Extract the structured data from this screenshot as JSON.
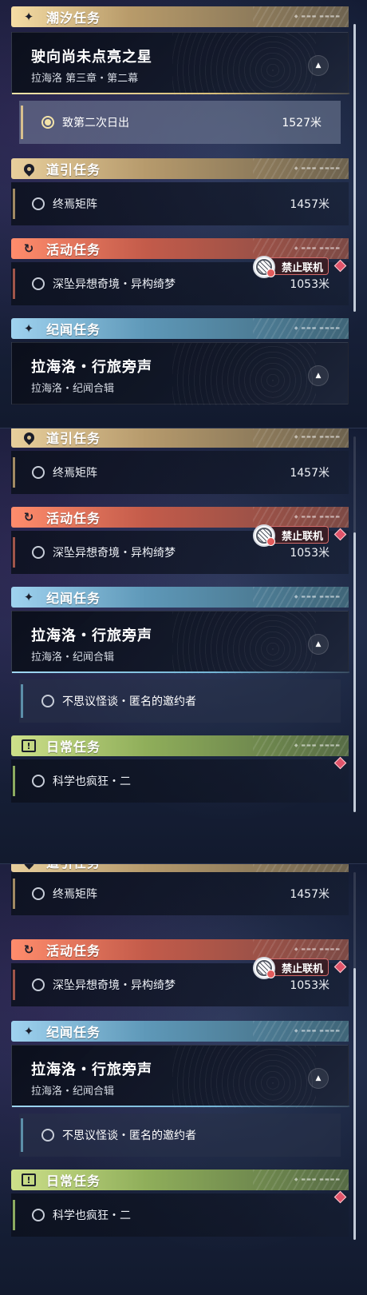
{
  "categories": {
    "tide": "潮汐任务",
    "guide": "道引任务",
    "event": "活动任务",
    "chronicle": "纪闻任务",
    "daily": "日常任务",
    "guide_cut": "道引任务"
  },
  "tide_quest": {
    "title": "驶向尚未点亮之星",
    "subtitle": "拉海洛 第三章・第二幕",
    "tracked_step": "致第二次日出",
    "tracked_distance": "1527米"
  },
  "guide_quest": {
    "name": "终焉矩阵",
    "distance": "1457米"
  },
  "event_quest": {
    "name": "深坠异想奇境・异构绮梦",
    "distance": "1053米",
    "badge": "禁止联机"
  },
  "chronicle_quest": {
    "title": "拉海洛・行旅旁声",
    "subtitle": "拉海洛・纪闻合辑",
    "sub_item": "不思议怪谈・匿名的邀约者"
  },
  "daily_quest": {
    "name": "科学也疯狂・二"
  },
  "icons": {
    "tide": "sparkle-icon",
    "guide": "map-pin-icon",
    "event": "cycle-icon",
    "chronicle": "sparkle-icon",
    "daily": "alert-icon",
    "collapse": "chevron-up-icon",
    "no_coop": "no-coop-icon"
  },
  "colors": {
    "tide": "#f5dca4",
    "guide": "#e8cf9c",
    "event": "#ff8c6c",
    "chronicle": "#9fd2ef",
    "daily": "#cde08a",
    "alert": "#e0546a"
  }
}
